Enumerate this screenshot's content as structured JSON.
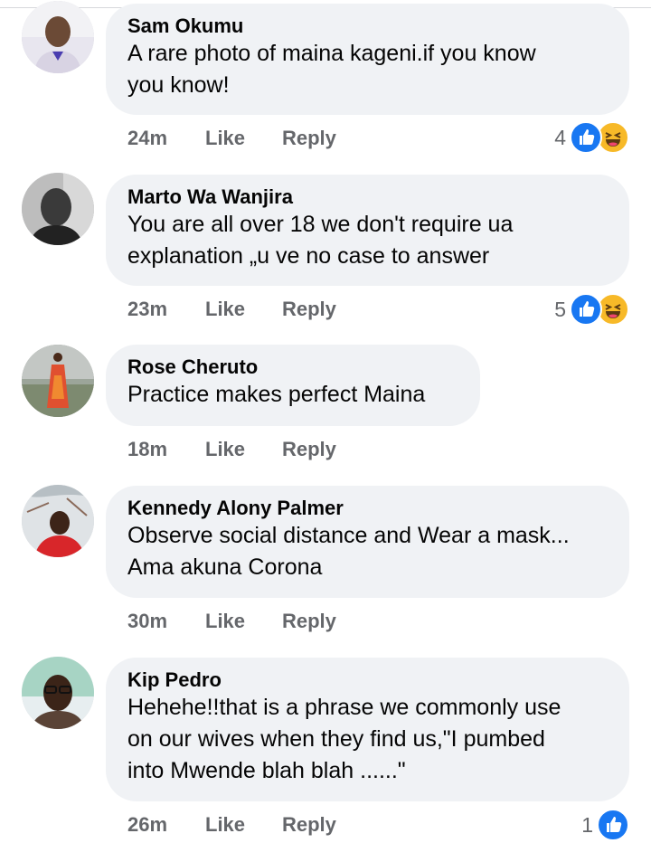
{
  "comments": [
    {
      "author": "Sam Okumu",
      "text": "A rare photo of maina kageni.if you know\nyou know!",
      "time": "24m",
      "like_label": "Like",
      "reply_label": "Reply",
      "reaction_count": "4",
      "reactions": [
        "like-icon",
        "haha-icon"
      ]
    },
    {
      "author": "Marto Wa Wanjira",
      "text": "You are all over 18 we don't require ua\nexplanation „u ve no case to answer",
      "time": "23m",
      "like_label": "Like",
      "reply_label": "Reply",
      "reaction_count": "5",
      "reactions": [
        "like-icon",
        "haha-icon"
      ]
    },
    {
      "author": "Rose Cheruto",
      "text": "Practice makes perfect Maina",
      "time": "18m",
      "like_label": "Like",
      "reply_label": "Reply",
      "reaction_count": "",
      "reactions": []
    },
    {
      "author": "Kennedy Alony Palmer",
      "text": "Observe social distance and Wear a mask...\nAma akuna Corona",
      "time": "30m",
      "like_label": "Like",
      "reply_label": "Reply",
      "reaction_count": "",
      "reactions": []
    },
    {
      "author": "Kip Pedro",
      "text": "Hehehe!!that is a phrase we commonly use\non our wives when they find us,\"I pumbed\ninto Mwende blah blah ......\"",
      "time": "26m",
      "like_label": "Like",
      "reply_label": "Reply",
      "reaction_count": "1",
      "reactions": [
        "like-icon"
      ]
    }
  ],
  "colors": {
    "bubble": "#f0f2f5",
    "meta_text": "#65676b",
    "like_blue": "#1877f2",
    "haha_yellow": "#f7b928"
  }
}
